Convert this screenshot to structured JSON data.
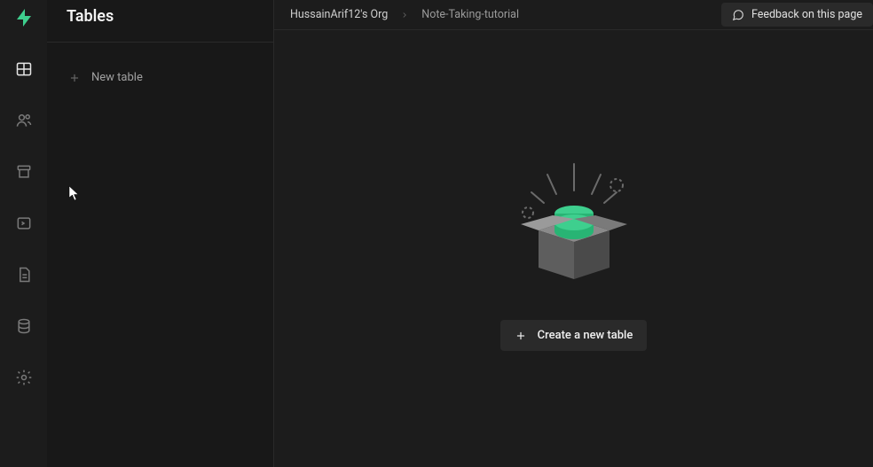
{
  "sidebar": {
    "title": "Tables",
    "new_table_label": "New table"
  },
  "breadcrumb": {
    "org": "HussainArif12's Org",
    "project": "Note-Taking-tutorial"
  },
  "topbar": {
    "feedback_label": "Feedback on this page"
  },
  "empty_state": {
    "create_label": "Create a new table"
  },
  "nav": {
    "items": [
      "tables",
      "auth",
      "storage",
      "sql",
      "docs",
      "database",
      "settings"
    ]
  },
  "colors": {
    "accent": "#3ecf8e",
    "bg": "#1c1c1c",
    "panel": "#2a2a2a"
  }
}
